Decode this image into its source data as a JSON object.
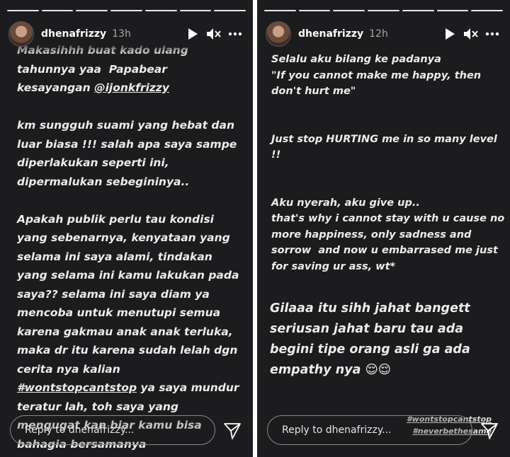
{
  "left_story": {
    "username": "dhenafrizzy",
    "time_ago": "13h",
    "text_intro": "Makasihhh buat kado ulang tahunnya yaa  Papabear kesayangan ",
    "mention": "@ijonkfrizzy",
    "text_body1": "\n\nkm sungguh suami yang hebat dan luar biasa !!! salah apa saya sampe diperlakukan seperti ini, dipermalukan sebegininya..\n\nApakah publik perlu tau kondisi yang sebenarnya, kenyataan yang selama ini saya alami, tindakan yang selama ini kamu lakukan pada saya?? selama ini saya diam ya mencoba untuk menutupi semua karena gakmau anak anak terluka, maka dr itu karena sudah lelah dgn cerita nya kalian ",
    "hashtag": "#wontstopcantstop",
    "text_body2": " ya saya mundur teratur lah, toh saya yang mengugat kan biar kamu bisa bahagia bersamanya",
    "reply_placeholder": "Reply to dhenafrizzy..."
  },
  "right_story": {
    "username": "dhenafrizzy",
    "time_ago": "12h",
    "text_upper": "Selalu aku bilang ke padanya\n\"If you cannot make me happy, then don't hurt me\"\n\n\nJust stop HURTING me in so many level !!\n\n\nAku nyerah, aku give up..\nthat's why i cannot stay with u cause no more happiness, only sadness and sorrow  and now u embarrased me just for saving ur ass, wt*",
    "text_lower": "Gilaaa itu sihh jahat bangett seriusan jahat baru tau ada begini tipe orang asli ga ada empathy nya ",
    "emoji": "😌😌",
    "hashtag_1": "#wontstopcantstop",
    "hashtag_2": "#neverbethesame",
    "reply_placeholder": "Reply to dhenafrizzy..."
  },
  "icons": {
    "play": "play-icon",
    "mute": "speaker-muted-icon",
    "more": "more-options-icon",
    "send": "send-icon"
  },
  "colors": {
    "story_bg": "#1c1c1e",
    "text": "#ececec",
    "muted": "#a8a8a8",
    "separator": "#ffffff"
  }
}
